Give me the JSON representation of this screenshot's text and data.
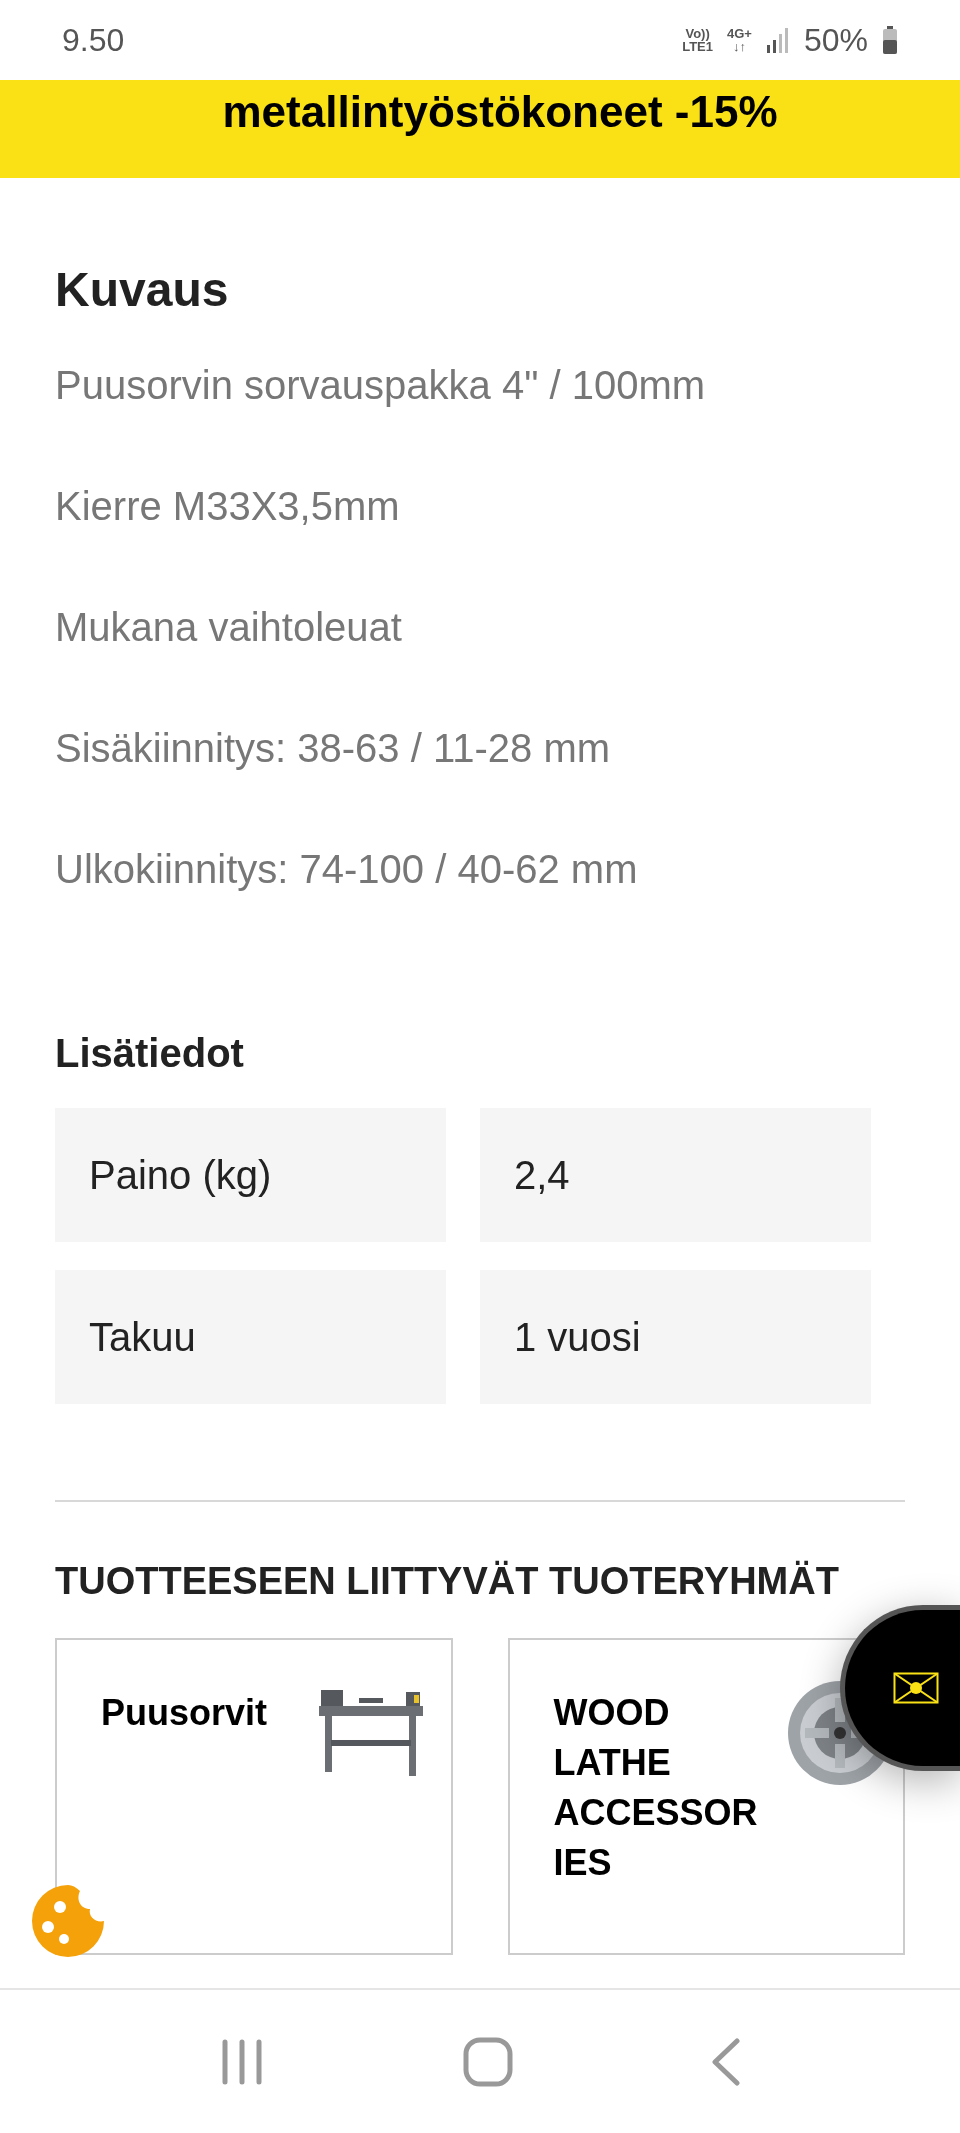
{
  "status_bar": {
    "time": "9.50",
    "network_top": "Vo))",
    "network_bottom": "LTE1",
    "data_top": "4G+",
    "data_bottom": "↓↑",
    "battery": "50%"
  },
  "banner": {
    "text": "metallintyöstökoneet -15%"
  },
  "description": {
    "title": "Kuvaus",
    "paragraphs": [
      "Puusorvin sorvauspakka 4\" / 100mm",
      "Kierre M33X3,5mm",
      "Mukana vaihtoleuat",
      "Sisäkiinnitys: 38-63 / 11-28 mm",
      "Ulkokiinnitys: 74-100 / 40-62 mm"
    ]
  },
  "additional_info": {
    "title": "Lisätiedot",
    "rows": [
      {
        "label": "Paino (kg)",
        "value": "2,4"
      },
      {
        "label": "Takuu",
        "value": "1 vuosi"
      }
    ]
  },
  "related_groups": {
    "title": "TUOTTEESEEN LIITTYVÄT TUOTERYHMÄT",
    "cards": [
      {
        "title": "Puusorvit",
        "kind": "lathe"
      },
      {
        "title": "WOOD LATHE ACCESSOR IES",
        "kind": "chuck"
      }
    ]
  }
}
